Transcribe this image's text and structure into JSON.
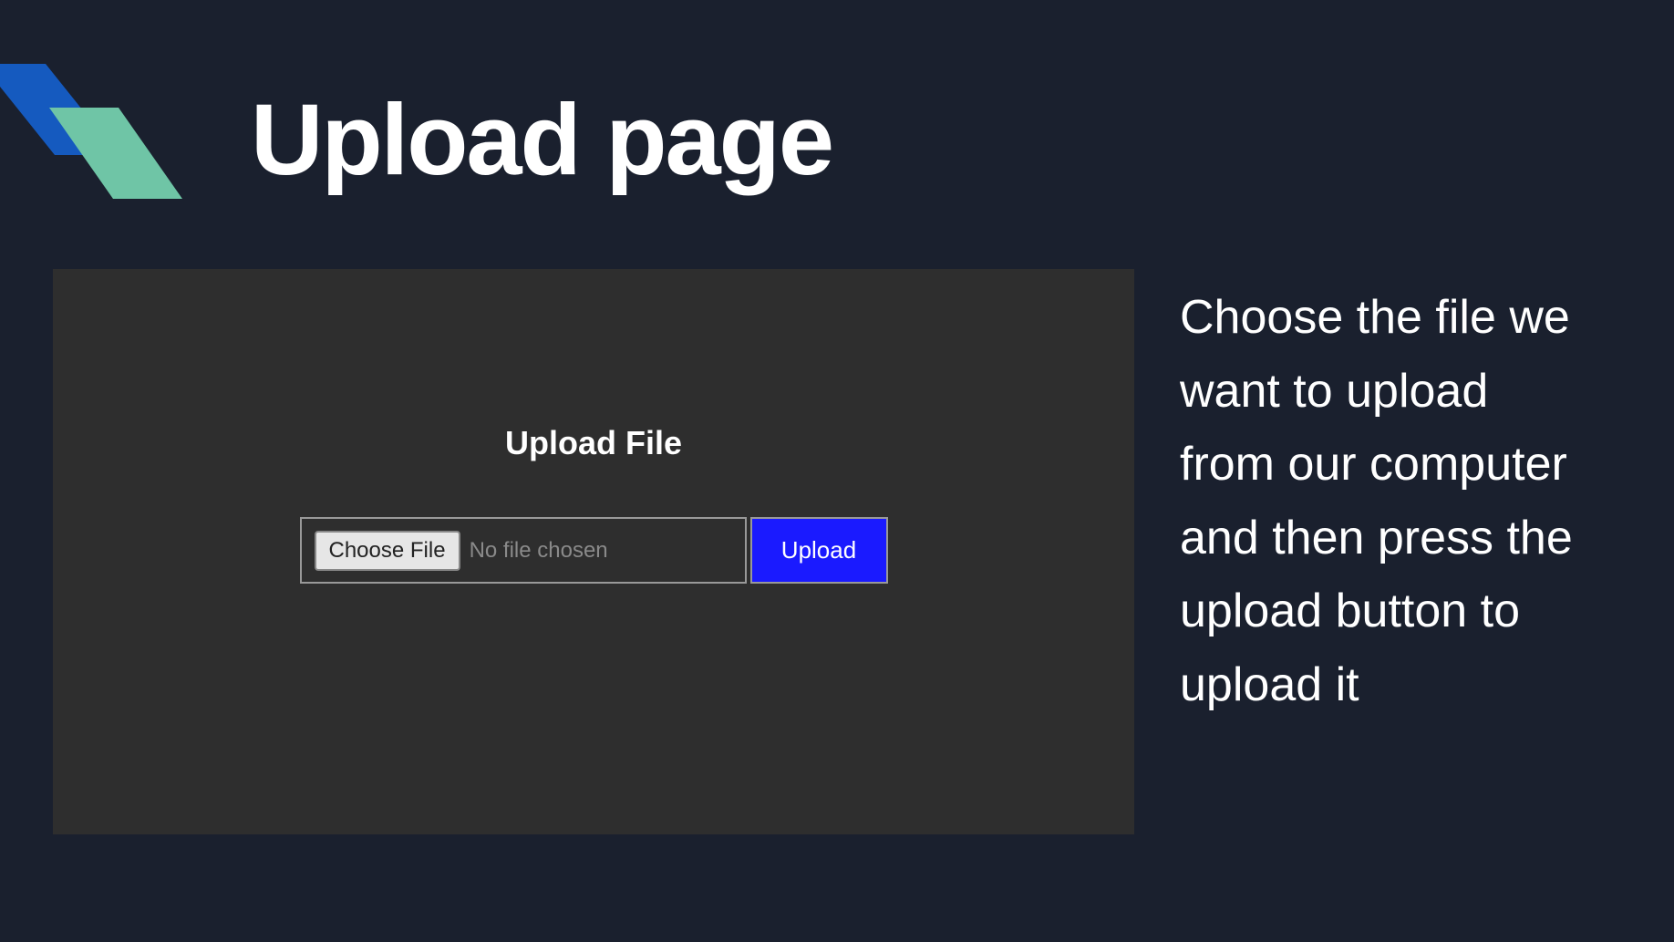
{
  "title": "Upload page",
  "panel": {
    "heading": "Upload File",
    "choose_file_label": "Choose File",
    "file_status": "No file chosen",
    "upload_button_label": "Upload"
  },
  "description": "Choose the file we want to upload from our computer and then press the upload button to upload it"
}
